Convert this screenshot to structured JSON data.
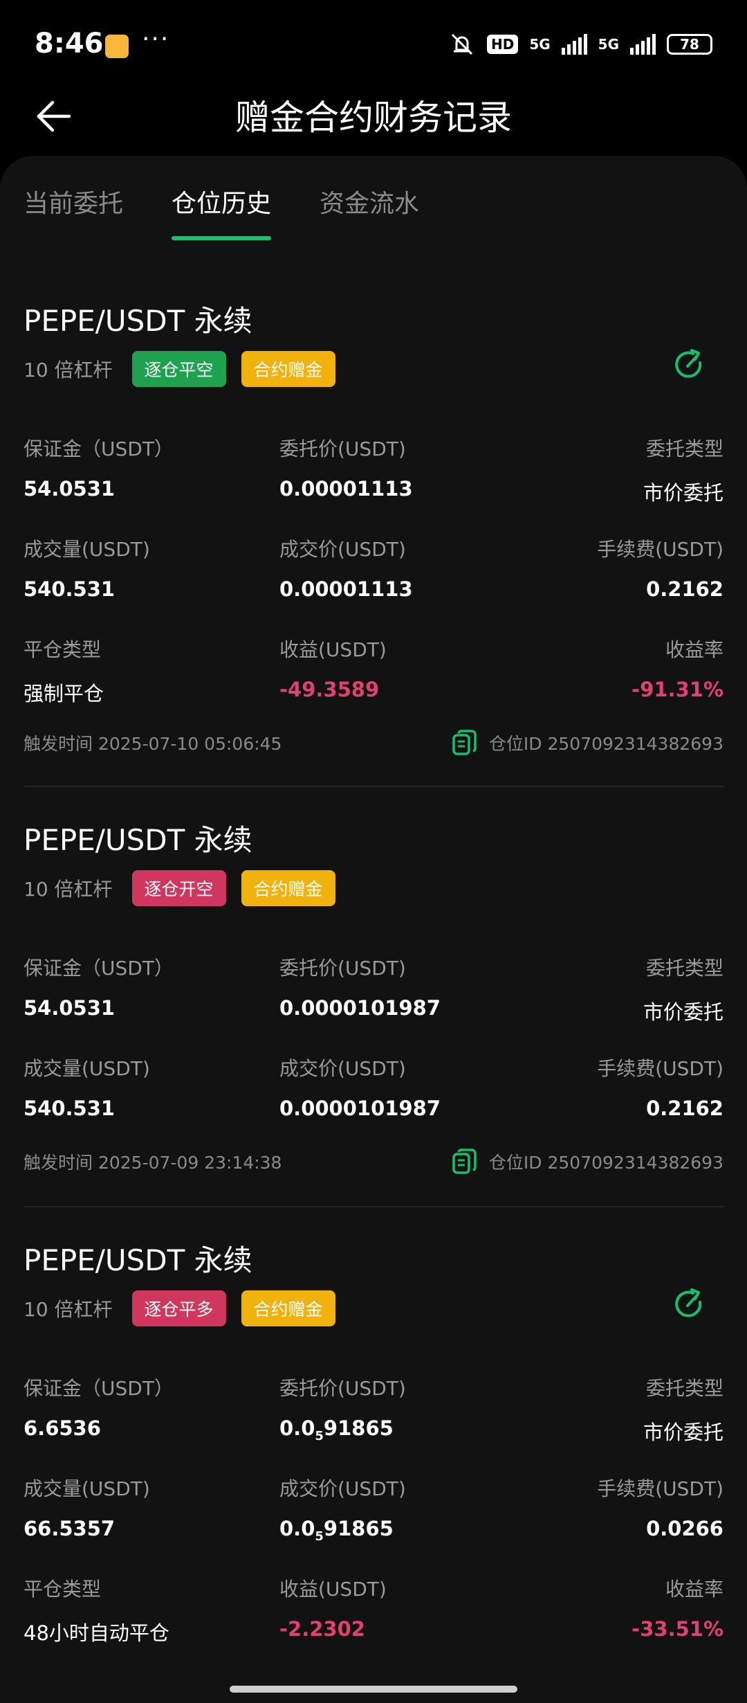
{
  "status_bar": {
    "time": "8:46",
    "dots": "···",
    "hd": "HD",
    "net1": "5G",
    "net2": "5G",
    "battery": "78"
  },
  "header": {
    "title": "赠金合约财务记录"
  },
  "tabs": [
    {
      "label": "当前委托",
      "active": false
    },
    {
      "label": "仓位历史",
      "active": true
    },
    {
      "label": "资金流水",
      "active": false
    }
  ],
  "colors": {
    "accent": "#14c06d",
    "negative": "#e0416e",
    "tag_green": "#1ea24f",
    "tag_red": "#d0365e",
    "tag_gold": "#f2b20e"
  },
  "records": [
    {
      "title": "PEPE/USDT 永续",
      "leverage": "10 倍杠杆",
      "side_tag": "逐仓平空",
      "bonus_tag": "合约赠金",
      "fields": [
        {
          "label": "保证金（USDT）",
          "value": "54.0531"
        },
        {
          "label": "委托价(USDT)",
          "value": "0.00001113"
        },
        {
          "label": "委托类型",
          "value": "市价委托"
        },
        {
          "label": "成交量(USDT)",
          "value": "540.531"
        },
        {
          "label": "成交价(USDT)",
          "value": "0.00001113"
        },
        {
          "label": "手续费(USDT)",
          "value": "0.2162"
        },
        {
          "label": "平仓类型",
          "value": "强制平仓"
        },
        {
          "label": "收益(USDT)",
          "value": "-49.3589"
        },
        {
          "label": "收益率",
          "value": "-91.31%"
        }
      ],
      "trigger_time": "触发时间 2025-07-10 05:06:45",
      "position_id": "仓位ID 2507092314382693"
    },
    {
      "title": "PEPE/USDT 永续",
      "leverage": "10 倍杠杆",
      "side_tag": "逐仓开空",
      "bonus_tag": "合约赠金",
      "fields": [
        {
          "label": "保证金（USDT）",
          "value": "54.0531"
        },
        {
          "label": "委托价(USDT)",
          "value": "0.0000101987"
        },
        {
          "label": "委托类型",
          "value": "市价委托"
        },
        {
          "label": "成交量(USDT)",
          "value": "540.531"
        },
        {
          "label": "成交价(USDT)",
          "value": "0.0000101987"
        },
        {
          "label": "手续费(USDT)",
          "value": "0.2162"
        }
      ],
      "trigger_time": "触发时间 2025-07-09 23:14:38",
      "position_id": "仓位ID 2507092314382693"
    },
    {
      "title": "PEPE/USDT 永续",
      "leverage": "10 倍杠杆",
      "side_tag": "逐仓平多",
      "bonus_tag": "合约赠金",
      "fields": [
        {
          "label": "保证金（USDT）",
          "value": "6.6536"
        },
        {
          "label": "委托价(USDT)",
          "value_main": "0.0",
          "value_sub": "5",
          "value_tail": "91865"
        },
        {
          "label": "委托类型",
          "value": "市价委托"
        },
        {
          "label": "成交量(USDT)",
          "value": "66.5357"
        },
        {
          "label": "成交价(USDT)",
          "value_main": "0.0",
          "value_sub": "5",
          "value_tail": "91865"
        },
        {
          "label": "手续费(USDT)",
          "value": "0.0266"
        },
        {
          "label": "平仓类型",
          "value": "48小时自动平仓"
        },
        {
          "label": "收益(USDT)",
          "value": "-2.2302"
        },
        {
          "label": "收益率",
          "value": "-33.51%"
        }
      ]
    }
  ]
}
